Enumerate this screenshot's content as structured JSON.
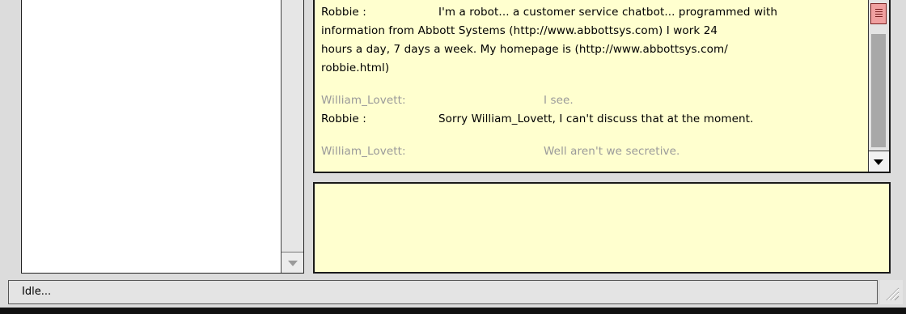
{
  "transcript": {
    "lines": [
      {
        "speaker": "Robbie :",
        "text": "I'm a robot... a customer service chatbot... programmed with"
      },
      {
        "text": "information from Abbott Systems (http://www.abbottsys.com)  I work 24"
      },
      {
        "text": "hours a day, 7 days a week. My homepage is (http://www.abbottsys.com/"
      },
      {
        "text": "robbie.html)"
      },
      {
        "speaker": "William_Lovett:",
        "text": "I see."
      },
      {
        "speaker": "Robbie :",
        "text": "Sorry William_Lovett,  I can't discuss that at the moment."
      },
      {
        "speaker": "William_Lovett:",
        "text": "Well aren't we secretive."
      }
    ]
  },
  "input": {
    "value": ""
  },
  "status": {
    "text": "Idle..."
  },
  "colors": {
    "pane_bg": "#ffffcf",
    "other_speaker": "#9a9a9a",
    "scroll_thumb": "#f0a0a0"
  }
}
